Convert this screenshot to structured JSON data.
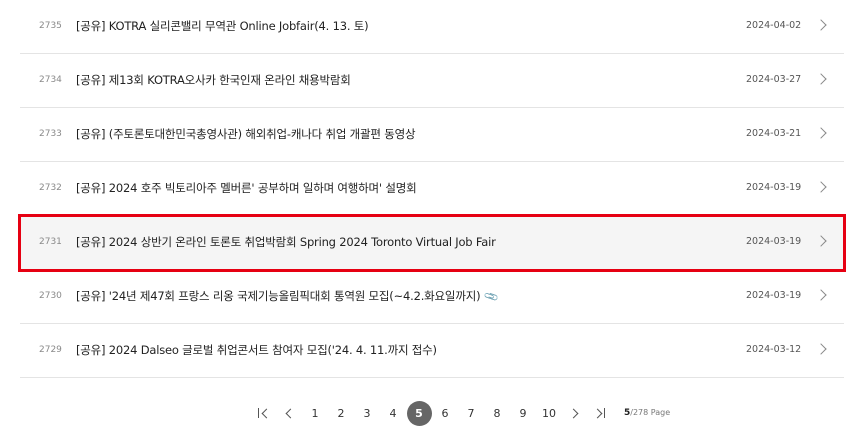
{
  "rows": [
    {
      "num": "2735",
      "title": "[공유] KOTRA 실리콘밸리 무역관 Online Jobfair(4. 13. 토)",
      "date": "2024-04-02",
      "attachment": false
    },
    {
      "num": "2734",
      "title": "[공유] 제13회 KOTRA오사카 한국인재 온라인 채용박람회",
      "date": "2024-03-27",
      "attachment": false
    },
    {
      "num": "2733",
      "title": "[공유] (주토론토대한민국총영사관) 해외취업-캐나다 취업 개괄편 동영상",
      "date": "2024-03-21",
      "attachment": false
    },
    {
      "num": "2732",
      "title": "[공유] 2024 호주 빅토리아주 멜버른' 공부하며 일하며 여행하며' 설명회",
      "date": "2024-03-19",
      "attachment": false
    },
    {
      "num": "2731",
      "title": "[공유] 2024 상반기 온라인 토론토 취업박람회 Spring 2024 Toronto Virtual Job Fair",
      "date": "2024-03-19",
      "attachment": false,
      "highlighted": true
    },
    {
      "num": "2730",
      "title": "[공유] '24년 제47회 프랑스 리옹 국제기능올림픽대회 통역원 모집(~4.2.화요일까지)",
      "date": "2024-03-19",
      "attachment": true
    },
    {
      "num": "2729",
      "title": "[공유] 2024 Dalseo 글로벌 취업콘서트 참여자 모집('24. 4. 11.까지 접수)",
      "date": "2024-03-12",
      "attachment": false
    }
  ],
  "pagination": {
    "pages": [
      "1",
      "2",
      "3",
      "4",
      "5",
      "6",
      "7",
      "8",
      "9",
      "10"
    ],
    "current": "5",
    "current_label": "5",
    "total_label": "/278 Page"
  },
  "icons": {
    "row_chevron": "chevron-right-icon",
    "attachment": "paperclip-icon",
    "first": "first-page-icon",
    "prev": "prev-page-icon",
    "next": "next-page-icon",
    "last": "last-page-icon"
  },
  "colors": {
    "highlight_border": "#e60012",
    "active_page_bg": "#666666",
    "divider": "#e4e4e4"
  }
}
